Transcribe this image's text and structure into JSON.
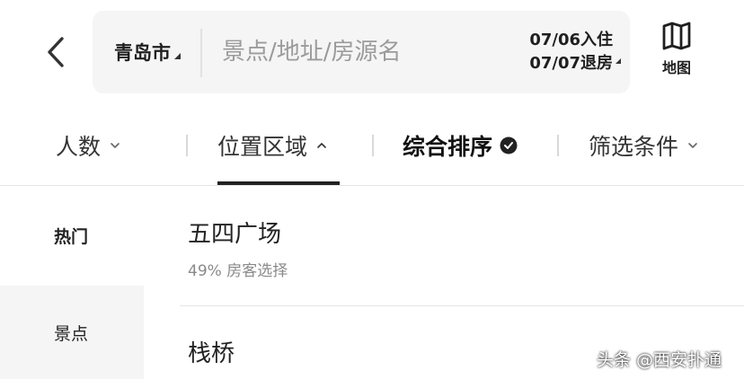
{
  "header": {
    "city": "青岛市",
    "search_placeholder": "景点/地址/房源名",
    "check_in": "07/06入住",
    "check_out": "07/07退房",
    "map_label": "地图"
  },
  "filters": {
    "guests": "人数",
    "location": "位置区域",
    "sort": "综合排序",
    "conditions": "筛选条件"
  },
  "left_nav": {
    "items": [
      {
        "label": "热门"
      },
      {
        "label": "景点"
      }
    ]
  },
  "list": {
    "items": [
      {
        "title": "五四广场",
        "subtitle": "49% 房客选择"
      },
      {
        "title": "栈桥"
      }
    ]
  },
  "watermark": "头条 @西安扑通",
  "colors": {
    "text_primary": "#222222",
    "text_secondary": "#8a8a8a",
    "search_bg": "#f5f5f5",
    "divider": "#e6e6e6",
    "selected_nav_bg": "#f5f5f5"
  },
  "icons": {
    "back": "chevron-left-icon",
    "map": "map-icon",
    "sort_selected": "check-circle-icon"
  }
}
